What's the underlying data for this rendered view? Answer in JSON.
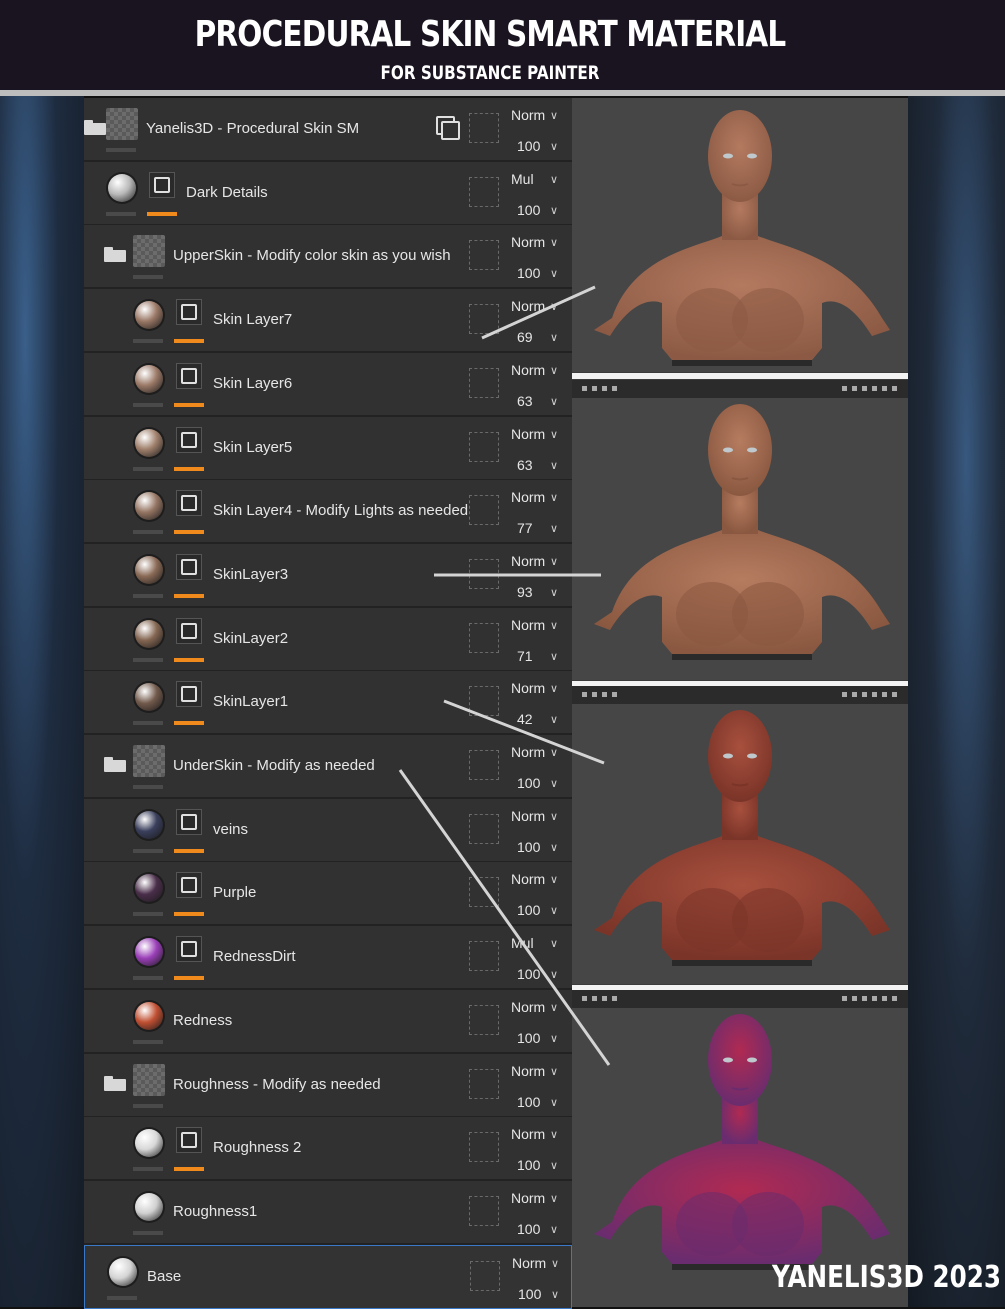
{
  "header": {
    "title": "PROCEDURAL SKIN SMART MATERIAL",
    "subtitle": "FOR SUBSTANCE PAINTER"
  },
  "watermark": "YANELIS3D 2023",
  "colors": {
    "header_bg": "#1a1320",
    "panel_bg": "#313131",
    "mask_bar": "#f08a1c",
    "selected_border": "#3a78c8"
  },
  "layers": [
    {
      "name": "Yanelis3D - Procedural Skin SM",
      "blend": "Norm",
      "opacity": "100",
      "kind": "folder-root"
    },
    {
      "name": "Dark Details",
      "blend": "Mul",
      "opacity": "100",
      "kind": "fill-mask",
      "sphere": "#b9b9b9"
    },
    {
      "name": "UpperSkin - Modify color skin as you wish",
      "blend": "Norm",
      "opacity": "100",
      "kind": "folder"
    },
    {
      "name": "Skin Layer7",
      "blend": "Norm",
      "opacity": "69",
      "kind": "fill-mask-indent",
      "sphere": "#9a7866"
    },
    {
      "name": "Skin Layer6",
      "blend": "Norm",
      "opacity": "63",
      "kind": "fill-mask-indent",
      "sphere": "#9c7a68"
    },
    {
      "name": "Skin Layer5",
      "blend": "Norm",
      "opacity": "63",
      "kind": "fill-mask-indent",
      "sphere": "#a0806c"
    },
    {
      "name": "Skin Layer4 - Modify Lights as needed",
      "blend": "Norm",
      "opacity": "77",
      "kind": "fill-mask-indent",
      "sphere": "#957563"
    },
    {
      "name": "SkinLayer3",
      "blend": "Norm",
      "opacity": "93",
      "kind": "fill-mask-indent",
      "sphere": "#8a6a56"
    },
    {
      "name": "SkinLayer2",
      "blend": "Norm",
      "opacity": "71",
      "kind": "fill-mask-indent",
      "sphere": "#846652"
    },
    {
      "name": "SkinLayer1",
      "blend": "Norm",
      "opacity": "42",
      "kind": "fill-mask-indent",
      "sphere": "#725a4c"
    },
    {
      "name": "UnderSkin - Modify as needed",
      "blend": "Norm",
      "opacity": "100",
      "kind": "folder"
    },
    {
      "name": "veins",
      "blend": "Norm",
      "opacity": "100",
      "kind": "fill-mask-indent",
      "sphere": "#3a3f5c"
    },
    {
      "name": "Purple",
      "blend": "Norm",
      "opacity": "100",
      "kind": "fill-mask-indent",
      "sphere": "#4a2e4a"
    },
    {
      "name": "RednessDirt",
      "blend": "Mul",
      "opacity": "100",
      "kind": "fill-mask-indent",
      "sphere": "#9a3fb8"
    },
    {
      "name": "Redness",
      "blend": "Norm",
      "opacity": "100",
      "kind": "fill-indent",
      "sphere": "#c05032"
    },
    {
      "name": "Roughness - Modify as needed",
      "blend": "Norm",
      "opacity": "100",
      "kind": "folder"
    },
    {
      "name": "Roughness 2",
      "blend": "Norm",
      "opacity": "100",
      "kind": "fill-mask-indent",
      "sphere": "#d8d8d8"
    },
    {
      "name": "Roughness1",
      "blend": "Norm",
      "opacity": "100",
      "kind": "fill-indent",
      "sphere": "#d0d0d0"
    },
    {
      "name": "Base",
      "blend": "Norm",
      "opacity": "100",
      "kind": "fill-root",
      "sphere": "#d4d4d4",
      "selected": true
    }
  ],
  "viewports": [
    {
      "skin": "#b47a60",
      "shade": "#8c5a44"
    },
    {
      "skin": "#b67c60",
      "shade": "#8a5840"
    },
    {
      "skin": "#a8503e",
      "shade": "#7a3428"
    },
    {
      "skin": "#b02a52",
      "shade": "#6a2c6e"
    }
  ]
}
